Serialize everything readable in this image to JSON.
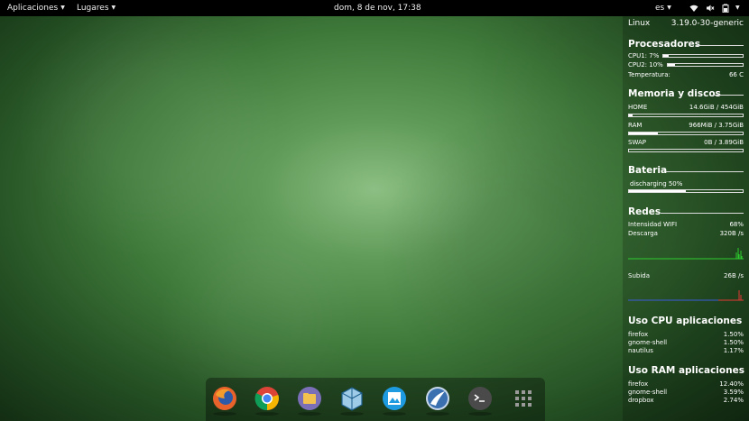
{
  "topbar": {
    "apps_label": "Aplicaciones",
    "places_label": "Lugares",
    "clock": "dom,  8 de nov, 17:38",
    "keyboard_layout": "es",
    "icons": [
      "wifi-icon",
      "speaker-muted-icon",
      "battery-icon",
      "chevron-down-icon"
    ]
  },
  "conky": {
    "system": {
      "label": "Linux",
      "value": "3.19.0-30-generic"
    },
    "cpu": {
      "title": "Procesadores",
      "cpu1_label": "CPU1: 7%",
      "cpu1_level": 0.07,
      "cpu2_label": "CPU2: 10%",
      "cpu2_level": 0.1,
      "temp_label": "Temperatura:",
      "temp_value": "66 C"
    },
    "memory": {
      "title": "Memoria y discos",
      "home_label": "HOME",
      "home_value": "14.6GiB / 454GiB",
      "home_level": 0.03,
      "ram_label": "RAM",
      "ram_value": "966MiB / 3.75GiB",
      "ram_level": 0.25,
      "swap_label": "SWAP",
      "swap_value": "0B  / 3.89GiB",
      "swap_level": 0.0
    },
    "battery": {
      "title": "Bateria",
      "status": "discharging 50%",
      "level": 0.5
    },
    "network": {
      "title": "Redes",
      "wifi_label": "Intensidad WIFI",
      "wifi_value": "68%",
      "down_label": "Descarga",
      "down_value": "320B  /s",
      "up_label": "Subida",
      "up_value": "26B  /s"
    },
    "cpu_apps": {
      "title": "Uso CPU aplicaciones",
      "rows": [
        {
          "name": "firefox",
          "value": "1.50%"
        },
        {
          "name": "gnome-shell",
          "value": "1.50%"
        },
        {
          "name": "nautilus",
          "value": "1.17%"
        }
      ]
    },
    "ram_apps": {
      "title": "Uso RAM aplicaciones",
      "rows": [
        {
          "name": "firefox",
          "value": "12.40%"
        },
        {
          "name": "gnome-shell",
          "value": "3.59%"
        },
        {
          "name": "dropbox",
          "value": "2.74%"
        }
      ]
    }
  },
  "dock": {
    "apps": [
      "firefox-icon",
      "chrome-icon",
      "files-icon",
      "virtualbox-icon",
      "image-viewer-icon",
      "browser-icon",
      "terminal-icon",
      "app-grid-icon"
    ]
  },
  "colors": {
    "desktop_center": "#8cbf83",
    "desktop_edge": "#132d13",
    "graph_down": "#2ecc2e",
    "graph_up": "#e53935"
  }
}
